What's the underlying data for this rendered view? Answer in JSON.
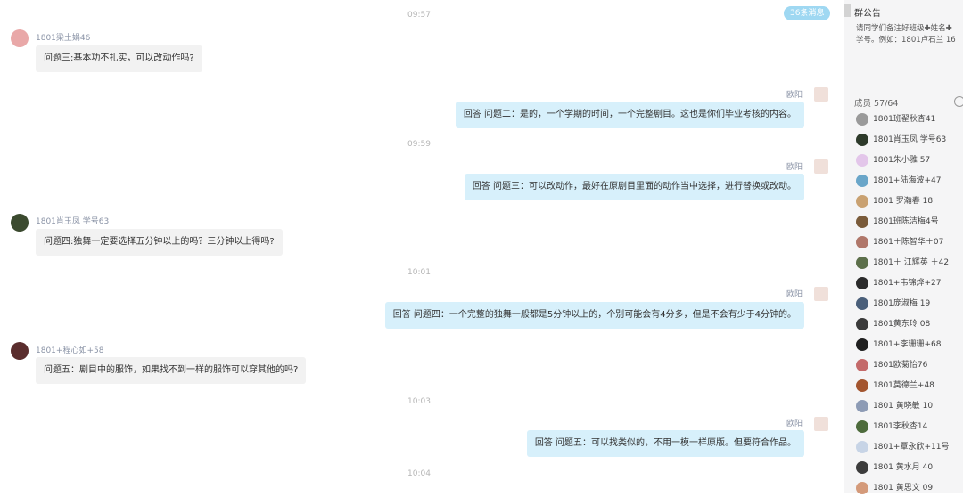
{
  "chat": {
    "unread_badge": "36条消息",
    "timestamps": [
      "09:57",
      "09:59",
      "10:01",
      "10:03",
      "10:04"
    ],
    "messages": [
      {
        "sender": "1801梁土娟46",
        "text": "问题三:基本功不扎实，可以改动作吗?"
      },
      {
        "sender": "欧阳",
        "text": "回答 问题二：是的，一个学期的时间，一个完整剧目。这也是你们毕业考核的内容。"
      },
      {
        "sender": "欧阳",
        "text": "回答 问题三：可以改动作，最好在原剧目里面的动作当中选择，进行替换或改动。"
      },
      {
        "sender": "1801肖玉凤  学号63",
        "text": "问题四:独舞一定要选择五分钟以上的吗？三分钟以上得吗?"
      },
      {
        "sender": "欧阳",
        "text": "回答 问题四：一个完整的独舞一般都是5分钟以上的，个别可能会有4分多，但是不会有少于4分钟的。"
      },
      {
        "sender": "1801+程心如+58",
        "text": "问题五：剧目中的服饰，如果找不到一样的服饰可以穿其他的吗?"
      },
      {
        "sender": "欧阳",
        "text": "回答 问题五：可以找类似的，不用一模一样原版。但要符合作品。"
      }
    ],
    "colors": {
      "incoming_bubble": "#f2f2f2",
      "outgoing_bubble": "#d7f0fb",
      "badge": "#9fd8f2"
    }
  },
  "sidebar": {
    "notice_title": "群公告",
    "notice_line1": "请同学们备注好班级✚姓名✚",
    "notice_line2": "学号。例如：1801卢石兰 16",
    "members_header": "成员 57/64",
    "members": [
      {
        "name": "1801班翟秋杏41",
        "color": "#9a9a9a"
      },
      {
        "name": "1801肖玉凤  学号63",
        "color": "#2d3a2a"
      },
      {
        "name": "1801朱小雅   57",
        "color": "#e3c6ea"
      },
      {
        "name": "1801+陆海波+47",
        "color": "#6aa6c9"
      },
      {
        "name": "1801 罗瀚春 18",
        "color": "#c9a171"
      },
      {
        "name": "1801班陈洁梅4号",
        "color": "#7a5b3a"
      },
      {
        "name": "1801＋陈智华＋07",
        "color": "#b0776a"
      },
      {
        "name": "1801＋ 江辉英 ＋42",
        "color": "#5c6f4a"
      },
      {
        "name": "1801+韦锦烨+27",
        "color": "#2b2b2b"
      },
      {
        "name": "1801庞淑梅 19",
        "color": "#4a5f7a"
      },
      {
        "name": "1801黄东玲 08",
        "color": "#3a3a3a"
      },
      {
        "name": "1801+李珊珊+68",
        "color": "#1f1f1f"
      },
      {
        "name": "1801欧菊怡76",
        "color": "#c46a6a"
      },
      {
        "name": "1801莫德兰+48",
        "color": "#a3552f"
      },
      {
        "name": "1801 黄晓敏 10",
        "color": "#8d9bb5"
      },
      {
        "name": "1801李秋杏14",
        "color": "#4d6b3c"
      },
      {
        "name": "1801+覃永欣+11号",
        "color": "#c7d4e6"
      },
      {
        "name": "1801 黄水月 40",
        "color": "#3c3c3c"
      },
      {
        "name": "1801 黄思文 09",
        "color": "#d49a7a"
      }
    ]
  }
}
